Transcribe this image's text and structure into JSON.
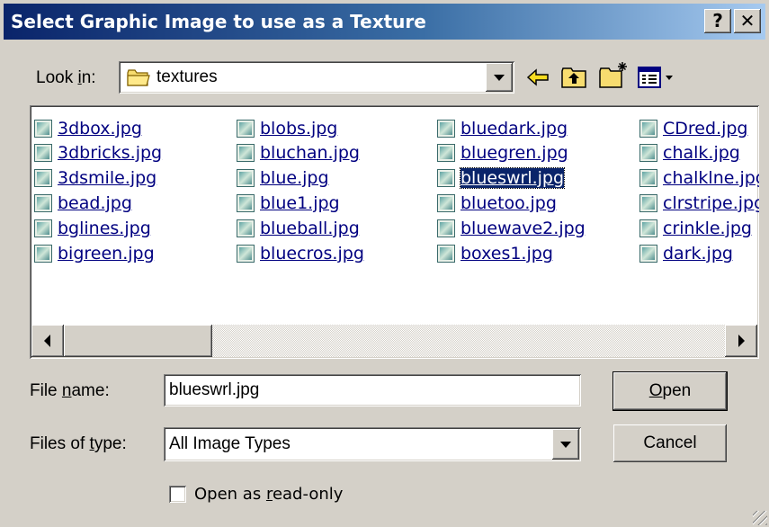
{
  "window": {
    "title": "Select Graphic Image to use as a Texture",
    "help_glyph": "?",
    "close_glyph": "✕"
  },
  "lookin": {
    "label_pre": "Look ",
    "label_ul": "i",
    "label_post": "n:",
    "value": "textures"
  },
  "toolbar": {
    "back_icon": "back-arrow-icon",
    "up_icon": "up-folder-icon",
    "new_folder_icon": "new-folder-icon",
    "view_icon": "view-menu-icon"
  },
  "files": [
    [
      "3dbox.jpg",
      "3dbricks.jpg",
      "3dsmile.jpg",
      "bead.jpg",
      "bglines.jpg",
      "bigreen.jpg"
    ],
    [
      "blobs.jpg",
      "bluchan.jpg",
      "blue.jpg",
      "blue1.jpg",
      "blueball.jpg",
      "bluecros.jpg"
    ],
    [
      "bluedark.jpg",
      "bluegren.jpg",
      "blueswrl.jpg",
      "bluetoo.jpg",
      "bluewave2.jpg",
      "boxes1.jpg"
    ],
    [
      "CDred.jpg",
      "chalk.jpg",
      "chalklne.jpg",
      "clrstripe.jpg",
      "crinkle.jpg",
      "dark.jpg"
    ]
  ],
  "selected_file": "blueswrl.jpg",
  "filename": {
    "label_pre": "File ",
    "label_ul": "n",
    "label_post": "ame:",
    "value": "blueswrl.jpg"
  },
  "filetype": {
    "label_pre": "Files of ",
    "label_ul": "t",
    "label_post": "ype:",
    "value": "All Image Types"
  },
  "readonly": {
    "label_pre": "Open as ",
    "label_ul": "r",
    "label_post": "ead-only",
    "checked": false
  },
  "buttons": {
    "open_ul": "O",
    "open_rest": "pen",
    "cancel": "Cancel"
  }
}
